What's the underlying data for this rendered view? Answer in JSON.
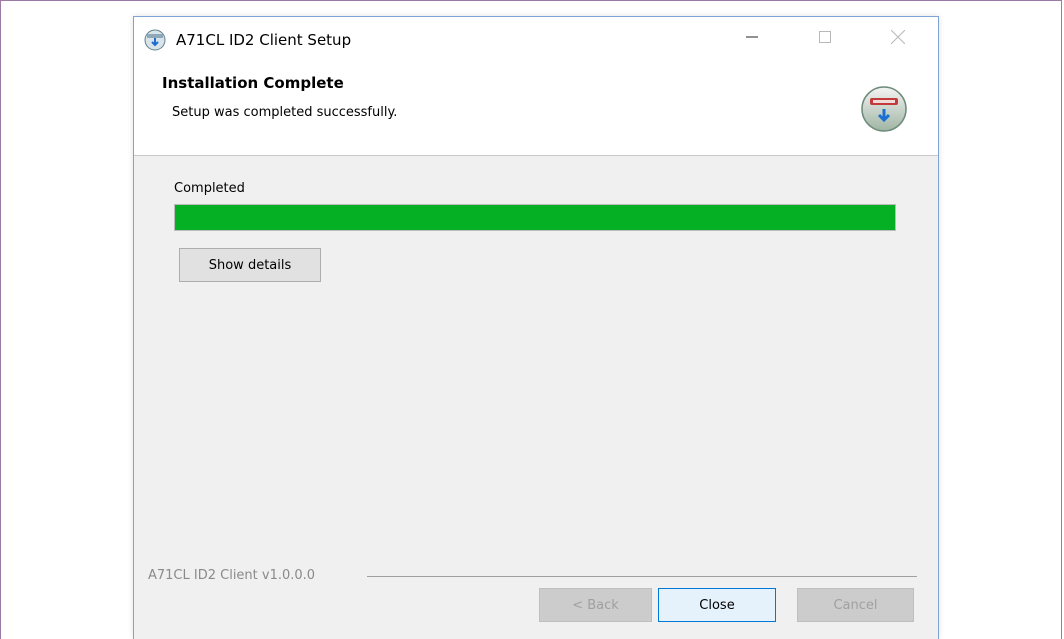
{
  "window": {
    "title": "A71CL ID2 Client Setup"
  },
  "header": {
    "title": "Installation Complete",
    "subtitle": "Setup was completed successfully."
  },
  "progress": {
    "label": "Completed",
    "value": 1.0,
    "color": "#06b025"
  },
  "buttons": {
    "show_details": "Show details",
    "back": "< Back",
    "close": "Close",
    "cancel": "Cancel"
  },
  "footer": {
    "brand": "A71CL ID2 Client v1.0.0.0"
  }
}
